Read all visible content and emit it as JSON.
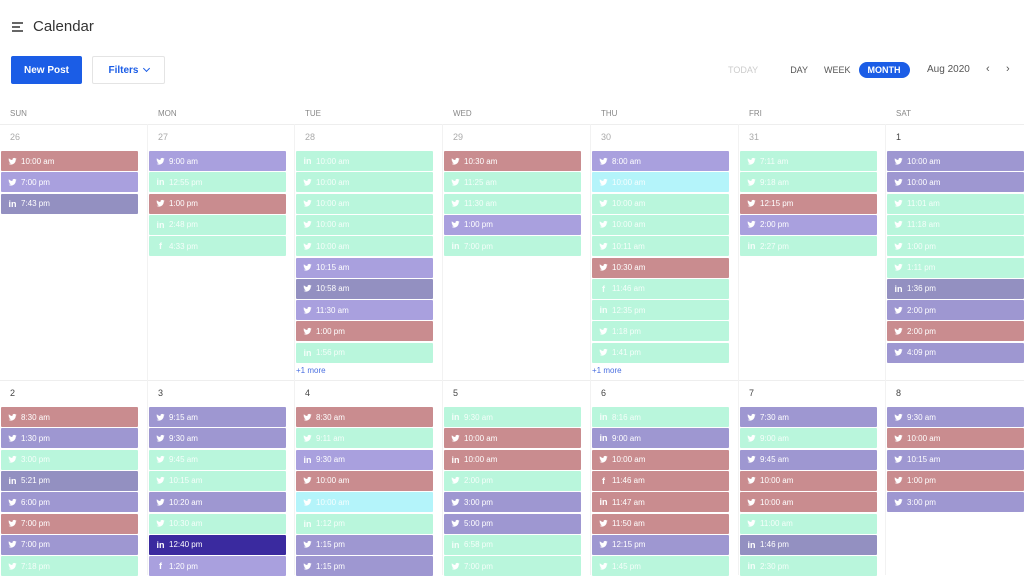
{
  "header": {
    "title": "Calendar",
    "menu_icon": "hamburger-icon"
  },
  "toolbar": {
    "new_post": "New Post",
    "filters": "Filters",
    "views": [
      "TODAY",
      "DAY",
      "WEEK",
      "MONTH"
    ],
    "active_view": "MONTH",
    "period": "Aug 2020",
    "prev": "‹",
    "next": "›"
  },
  "weekdays": [
    "SUN",
    "MON",
    "TUE",
    "WED",
    "THU",
    "FRI",
    "SAT"
  ],
  "colors": {
    "r": "#c98c8f",
    "p": "#a9a0de",
    "q": "#9e97d1",
    "d": "#9390c1",
    "g": "#b9f6dc",
    "c": "#b4f4fa",
    "n": "#3a2a9f"
  },
  "weeks": [
    {
      "days": [
        {
          "date": "26",
          "events": [
            [
              "twitter",
              "10:00 am",
              "r"
            ],
            [
              "twitter",
              "7:00 pm",
              "p"
            ],
            [
              "linkedin",
              "7:43 pm",
              "d"
            ]
          ]
        },
        {
          "date": "27",
          "events": [
            [
              "twitter",
              "9:00 am",
              "p"
            ],
            [
              "linkedin",
              "12:55 pm",
              "g"
            ],
            [
              "twitter",
              "1:00 pm",
              "r"
            ],
            [
              "linkedin",
              "2:48 pm",
              "g"
            ],
            [
              "facebook",
              "4:33 pm",
              "g"
            ]
          ]
        },
        {
          "date": "28",
          "events": [
            [
              "linkedin",
              "10:00 am",
              "g"
            ],
            [
              "twitter",
              "10:00 am",
              "g"
            ],
            [
              "twitter",
              "10:00 am",
              "g"
            ],
            [
              "twitter",
              "10:00 am",
              "g"
            ],
            [
              "twitter",
              "10:00 am",
              "g"
            ],
            [
              "twitter",
              "10:15 am",
              "p"
            ],
            [
              "twitter",
              "10:58 am",
              "d"
            ],
            [
              "twitter",
              "11:30 am",
              "p"
            ],
            [
              "twitter",
              "1:00 pm",
              "r"
            ],
            [
              "linkedin",
              "1:56 pm",
              "g"
            ]
          ],
          "more": "+1 more"
        },
        {
          "date": "29",
          "events": [
            [
              "twitter",
              "10:30 am",
              "r"
            ],
            [
              "twitter",
              "11:25 am",
              "g"
            ],
            [
              "twitter",
              "11:30 am",
              "g"
            ],
            [
              "twitter",
              "1:00 pm",
              "p"
            ],
            [
              "linkedin",
              "7:00 pm",
              "g"
            ]
          ]
        },
        {
          "date": "30",
          "events": [
            [
              "twitter",
              "8:00 am",
              "p"
            ],
            [
              "twitter",
              "10:00 am",
              "c"
            ],
            [
              "twitter",
              "10:00 am",
              "g"
            ],
            [
              "twitter",
              "10:00 am",
              "g"
            ],
            [
              "twitter",
              "10:11 am",
              "g"
            ],
            [
              "twitter",
              "10:30 am",
              "r"
            ],
            [
              "facebook",
              "11:46 am",
              "g"
            ],
            [
              "linkedin",
              "12:35 pm",
              "g"
            ],
            [
              "twitter",
              "1:18 pm",
              "g"
            ],
            [
              "twitter",
              "1:41 pm",
              "g"
            ]
          ],
          "more": "+1 more"
        },
        {
          "date": "31",
          "events": [
            [
              "twitter",
              "7:11 am",
              "g"
            ],
            [
              "twitter",
              "9:18 am",
              "g"
            ],
            [
              "twitter",
              "12:15 pm",
              "r"
            ],
            [
              "twitter",
              "2:00 pm",
              "p"
            ],
            [
              "linkedin",
              "2:27 pm",
              "g"
            ]
          ]
        },
        {
          "date": "1",
          "current": true,
          "events": [
            [
              "twitter",
              "10:00 am",
              "q"
            ],
            [
              "twitter",
              "10:00 am",
              "q"
            ],
            [
              "twitter",
              "11:01 am",
              "g"
            ],
            [
              "twitter",
              "11:18 am",
              "g"
            ],
            [
              "twitter",
              "1:00 pm",
              "g"
            ],
            [
              "twitter",
              "1:11 pm",
              "g"
            ],
            [
              "linkedin",
              "1:36 pm",
              "d"
            ],
            [
              "twitter",
              "2:00 pm",
              "q"
            ],
            [
              "twitter",
              "2:00 pm",
              "r"
            ],
            [
              "twitter",
              "4:09 pm",
              "q"
            ]
          ]
        }
      ]
    },
    {
      "days": [
        {
          "date": "2",
          "current": true,
          "events": [
            [
              "twitter",
              "8:30 am",
              "r"
            ],
            [
              "twitter",
              "1:30 pm",
              "q"
            ],
            [
              "twitter",
              "3:00 pm",
              "g"
            ],
            [
              "linkedin",
              "5:21 pm",
              "d"
            ],
            [
              "twitter",
              "6:00 pm",
              "q"
            ],
            [
              "twitter",
              "7:00 pm",
              "r"
            ],
            [
              "twitter",
              "7:00 pm",
              "q"
            ],
            [
              "twitter",
              "7:18 pm",
              "g"
            ]
          ]
        },
        {
          "date": "3",
          "current": true,
          "events": [
            [
              "twitter",
              "9:15 am",
              "q"
            ],
            [
              "twitter",
              "9:30 am",
              "q"
            ],
            [
              "twitter",
              "9:45 am",
              "g"
            ],
            [
              "twitter",
              "10:15 am",
              "g"
            ],
            [
              "twitter",
              "10:20 am",
              "q"
            ],
            [
              "twitter",
              "10:30 am",
              "g"
            ],
            [
              "linkedin",
              "12:40 pm",
              "n"
            ],
            [
              "facebook",
              "1:20 pm",
              "p"
            ]
          ]
        },
        {
          "date": "4",
          "current": true,
          "events": [
            [
              "twitter",
              "8:30 am",
              "r"
            ],
            [
              "twitter",
              "9:11 am",
              "g"
            ],
            [
              "linkedin",
              "9:30 am",
              "p"
            ],
            [
              "twitter",
              "10:00 am",
              "r"
            ],
            [
              "twitter",
              "10:00 am",
              "c"
            ],
            [
              "linkedin",
              "1:12 pm",
              "g"
            ],
            [
              "twitter",
              "1:15 pm",
              "q"
            ],
            [
              "twitter",
              "1:15 pm",
              "q"
            ]
          ]
        },
        {
          "date": "5",
          "current": true,
          "events": [
            [
              "linkedin",
              "9:30 am",
              "g"
            ],
            [
              "twitter",
              "10:00 am",
              "r"
            ],
            [
              "linkedin",
              "10:00 am",
              "r"
            ],
            [
              "twitter",
              "2:00 pm",
              "g"
            ],
            [
              "twitter",
              "3:00 pm",
              "q"
            ],
            [
              "twitter",
              "5:00 pm",
              "q"
            ],
            [
              "linkedin",
              "6:58 pm",
              "g"
            ],
            [
              "twitter",
              "7:00 pm",
              "g"
            ]
          ]
        },
        {
          "date": "6",
          "current": true,
          "events": [
            [
              "linkedin",
              "8:16 am",
              "g"
            ],
            [
              "linkedin",
              "9:00 am",
              "q"
            ],
            [
              "twitter",
              "10:00 am",
              "r"
            ],
            [
              "facebook",
              "11:46 am",
              "r"
            ],
            [
              "linkedin",
              "11:47 am",
              "r"
            ],
            [
              "twitter",
              "11:50 am",
              "r"
            ],
            [
              "twitter",
              "12:15 pm",
              "q"
            ],
            [
              "twitter",
              "1:45 pm",
              "g"
            ]
          ]
        },
        {
          "date": "7",
          "current": true,
          "events": [
            [
              "twitter",
              "7:30 am",
              "q"
            ],
            [
              "twitter",
              "9:00 am",
              "g"
            ],
            [
              "twitter",
              "9:45 am",
              "q"
            ],
            [
              "twitter",
              "10:00 am",
              "r"
            ],
            [
              "twitter",
              "10:00 am",
              "r"
            ],
            [
              "twitter",
              "11:00 am",
              "g"
            ],
            [
              "linkedin",
              "1:46 pm",
              "d"
            ],
            [
              "linkedin",
              "2:30 pm",
              "g"
            ]
          ]
        },
        {
          "date": "8",
          "current": true,
          "events": [
            [
              "twitter",
              "9:30 am",
              "q"
            ],
            [
              "twitter",
              "10:00 am",
              "r"
            ],
            [
              "twitter",
              "10:15 am",
              "q"
            ],
            [
              "twitter",
              "1:00 pm",
              "r"
            ],
            [
              "twitter",
              "3:00 pm",
              "q"
            ]
          ]
        }
      ]
    }
  ]
}
